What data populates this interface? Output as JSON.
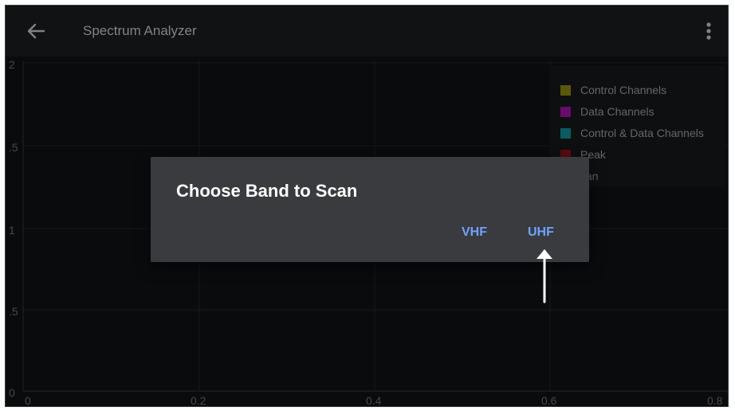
{
  "app": {
    "title": "Spectrum Analyzer"
  },
  "icons": {
    "back": "arrow-left-icon",
    "menu": "more-vertical-icon"
  },
  "chart": {
    "y_ticks": [
      "2",
      ".5",
      "1",
      ".5",
      "0"
    ],
    "x_ticks": [
      "0",
      "0.2",
      "0.4",
      "0.6",
      "0.8"
    ]
  },
  "legend": {
    "items": [
      {
        "label": "Control Channels",
        "color": "#8a8a10"
      },
      {
        "label": "Data Channels",
        "color": "#a012a6"
      },
      {
        "label": "Control & Data Channels",
        "color": "#0f8f95"
      },
      {
        "label": "Peak",
        "color": "#8b1114"
      },
      {
        "label": "can",
        "color": "#2a2b2e"
      }
    ]
  },
  "dialog": {
    "title": "Choose Band to Scan",
    "buttons": {
      "vhf": "VHF",
      "uhf": "UHF"
    }
  },
  "colors": {
    "accent": "#6ea3ff",
    "dialog_bg": "#3a3b3e",
    "appbar": "#1b1c1f"
  }
}
